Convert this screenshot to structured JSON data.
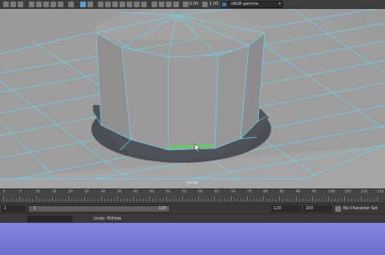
{
  "toolbar": {
    "value_a": "0.00",
    "value_b": "1.00",
    "gamma_select": "sRGB gamma"
  },
  "viewport": {
    "camera_label": "persp"
  },
  "timeline": {
    "ticks": [
      "1",
      "5",
      "10",
      "15",
      "20",
      "25",
      "30",
      "35",
      "40",
      "45",
      "50",
      "55",
      "60",
      "65",
      "70",
      "75",
      "80",
      "85",
      "90",
      "95",
      "100",
      "105",
      "110",
      "115"
    ]
  },
  "range": {
    "start": "1",
    "slider_start": "1",
    "slider_end": "120",
    "end": "120",
    "anim_end": "200",
    "character_set": "No Character Set"
  },
  "command": {
    "undo_text": "Undo: FillHole"
  },
  "colors": {
    "wire": "#66d8f2",
    "selected_edge": "#49e23e",
    "mesh_face": "#9a9a9a"
  }
}
